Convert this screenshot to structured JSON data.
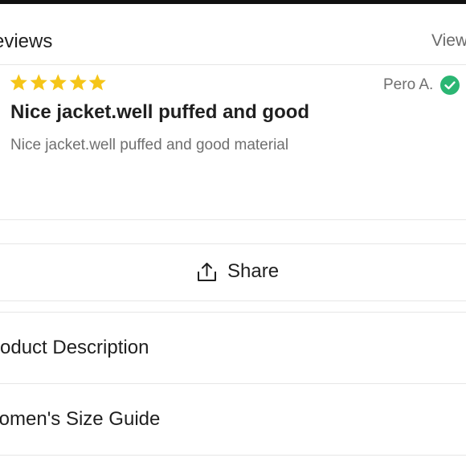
{
  "reviews_section": {
    "title": "eviews",
    "view_link": "View"
  },
  "review": {
    "rating": 5,
    "rating_max": 5,
    "star_color": "#f5c518",
    "reviewer": "Pero A.",
    "verified_color": "#2bb673",
    "title": "Nice jacket.well puffed and good",
    "body": "Nice jacket.well puffed and good material"
  },
  "share": {
    "label": "Share",
    "icon": "share-icon"
  },
  "accordion": [
    {
      "label": "roduct Description"
    },
    {
      "label": "/omen's Size Guide"
    }
  ]
}
